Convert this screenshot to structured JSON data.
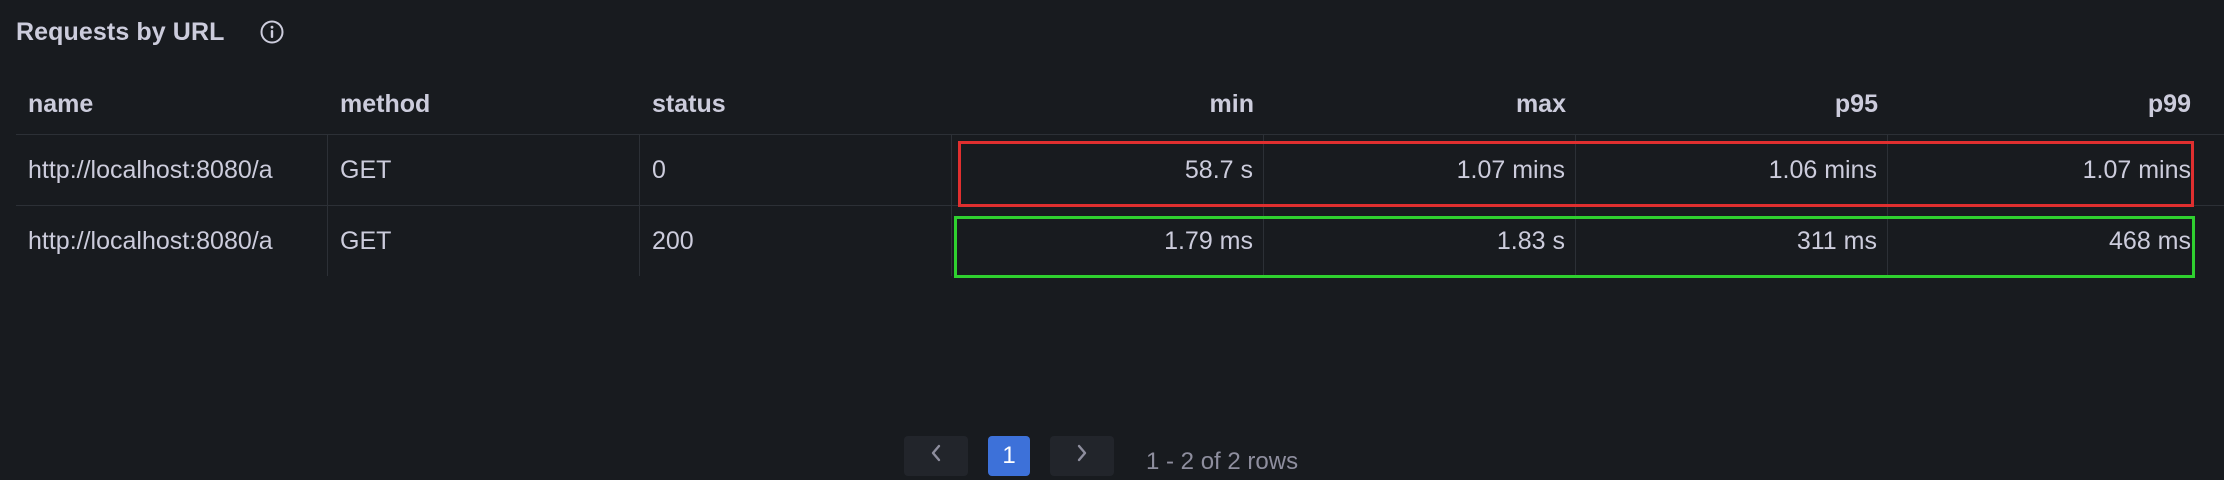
{
  "panel": {
    "title": "Requests by URL",
    "info_icon": "info-circle-icon"
  },
  "table": {
    "columns": [
      "name",
      "method",
      "status",
      "min",
      "max",
      "p95",
      "p99"
    ],
    "rows": [
      {
        "name": "http://localhost:8080/a",
        "method": "GET",
        "status": "0",
        "min": "58.7 s",
        "max": "1.07 mins",
        "p95": "1.06 mins",
        "p99": "1.07 mins"
      },
      {
        "name": "http://localhost:8080/a",
        "method": "GET",
        "status": "200",
        "min": "1.79 ms",
        "max": "1.83 s",
        "p95": "311 ms",
        "p99": "468 ms"
      }
    ]
  },
  "highlights": {
    "row_0_color": "#e02f2f",
    "row_1_color": "#2fd12f"
  },
  "pagination": {
    "prev_icon": "chevron-left-icon",
    "current_page": "1",
    "next_icon": "chevron-right-icon",
    "summary": "1 - 2 of 2 rows"
  },
  "colors": {
    "background": "#181b1f",
    "text": "#ccccdc",
    "active_page": "#3d71d9"
  }
}
